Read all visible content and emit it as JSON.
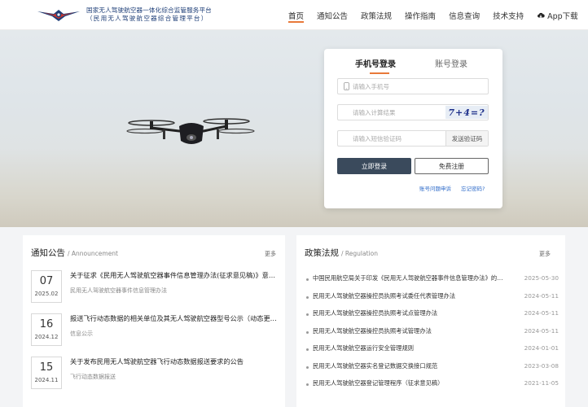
{
  "header": {
    "brand_line1": "国家无人驾驶航空器一体化综合监管服务平台",
    "brand_line2": "（民用无人驾驶航空器综合管理平台）",
    "nav": [
      "首页",
      "通知公告",
      "政策法规",
      "操作指南",
      "信息查询",
      "技术支持",
      "App下载"
    ]
  },
  "login": {
    "tab_phone": "手机号登录",
    "tab_account": "账号登录",
    "phone_placeholder": "请输入手机号",
    "captcha_placeholder": "请输入计算结果",
    "captcha_text": "7+4=?",
    "sms_placeholder": "请输入短信验证码",
    "sms_button": "发送验证码",
    "login_button": "立即登录",
    "register_button": "免费注册",
    "appeal_link": "账号问题申诉",
    "forgot_link": "忘记密码?"
  },
  "notices": {
    "title": "通知公告",
    "subtitle": "/ Announcement",
    "more": "更多",
    "items": [
      {
        "day": "07",
        "ym": "2025.02",
        "title": "关于征求《民用无人驾驶航空器事件信息管理办法(征求意见稿)》意见的通知",
        "sub": "民用无人驾驶航空器事件信息管理办法"
      },
      {
        "day": "16",
        "ym": "2024.12",
        "title": "报送飞行动态数据的相关单位及其无人驾驶航空器型号公示（动态更新）",
        "sub": "信息公示"
      },
      {
        "day": "15",
        "ym": "2024.11",
        "title": "关于发布民用无人驾驶航空器飞行动态数据报送要求的公告",
        "sub": "飞行动态数据报送"
      }
    ]
  },
  "regulations": {
    "title": "政策法规",
    "subtitle": "/ Regulation",
    "more": "更多",
    "items": [
      {
        "title": "中国民用航空局关于印发《民用无人驾驶航空器事件信息管理办法》的通知",
        "date": "2025-05-30"
      },
      {
        "title": "民用无人驾驶航空器操控员执照考试委任代表管理办法",
        "date": "2024-05-11"
      },
      {
        "title": "民用无人驾驶航空器操控员执照考试点管理办法",
        "date": "2024-05-11"
      },
      {
        "title": "民用无人驾驶航空器操控员执照考试管理办法",
        "date": "2024-05-11"
      },
      {
        "title": "民用无人驾驶航空器运行安全管理规则",
        "date": "2024-01-01"
      },
      {
        "title": "民用无人驾驶航空器实名登记数据交换接口规范",
        "date": "2023-03-08"
      },
      {
        "title": "民用无人驾驶航空器登记管理程序（征求意见稿）",
        "date": "2021-11-05"
      }
    ]
  },
  "colors": {
    "accent": "#e8793a",
    "primary_button": "#3a4a5c",
    "link": "#2e6bc9",
    "brand": "#1f3f78"
  }
}
